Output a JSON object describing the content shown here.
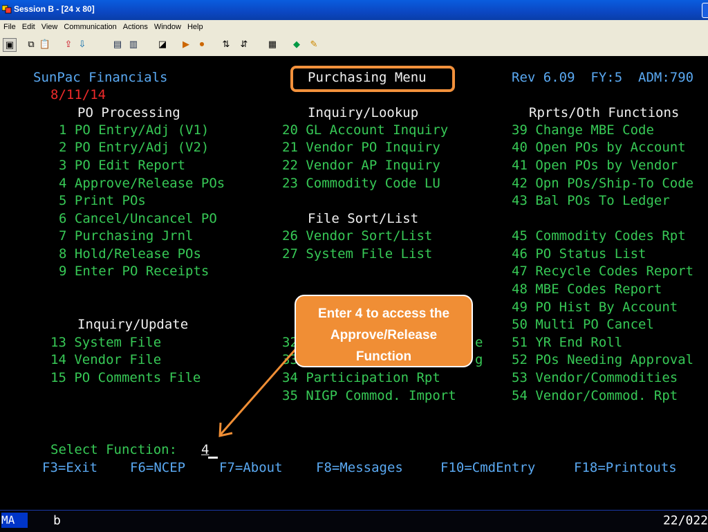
{
  "window": {
    "title": "Session B - [24 x 80]"
  },
  "menu": [
    "File",
    "Edit",
    "View",
    "Communication",
    "Actions",
    "Window",
    "Help"
  ],
  "toolbar_icons": [
    "print-screen-icon",
    "copy-icon",
    "paste-icon",
    "send-icon",
    "receive-icon",
    "display-icon",
    "stop-icon",
    "macro-icon",
    "record-icon",
    "play-icon",
    "transfer-icon",
    "transfer-icon",
    "clipboard-icon",
    "color-icon",
    "edit-icon"
  ],
  "header": {
    "company": "SunPac Financials",
    "menu_title": "Purchasing Menu",
    "rev": "Rev 6.09  FY:5  ADM:790",
    "date": "8/11/14"
  },
  "col1": {
    "heading": "PO Processing",
    "items": [
      {
        "num": "1",
        "label": "PO Entry/Adj (V1)"
      },
      {
        "num": "2",
        "label": "PO Entry/Adj (V2)"
      },
      {
        "num": "3",
        "label": "PO Edit Report"
      },
      {
        "num": "4",
        "label": "Approve/Release POs"
      },
      {
        "num": "5",
        "label": "Print POs"
      },
      {
        "num": "6",
        "label": "Cancel/Uncancel PO"
      },
      {
        "num": "7",
        "label": "Purchasing Jrnl"
      },
      {
        "num": "8",
        "label": "Hold/Release POs"
      },
      {
        "num": "9",
        "label": "Enter PO Receipts"
      }
    ],
    "heading2": "Inquiry/Update",
    "items2": [
      {
        "num": "13",
        "label": "System File"
      },
      {
        "num": "14",
        "label": "Vendor File"
      },
      {
        "num": "15",
        "label": "PO Comments File"
      }
    ]
  },
  "col2": {
    "heading": "Inquiry/Lookup",
    "items": [
      {
        "num": "20",
        "label": "GL Account Inquiry"
      },
      {
        "num": "21",
        "label": "Vendor PO Inquiry"
      },
      {
        "num": "22",
        "label": "Vendor AP Inquiry"
      },
      {
        "num": "23",
        "label": "Commodity Code LU"
      }
    ],
    "heading2": "File Sort/List",
    "items2": [
      {
        "num": "26",
        "label": "Vendor Sort/List"
      },
      {
        "num": "27",
        "label": "System File List"
      }
    ],
    "partial": [
      {
        "num": "32",
        "label": "e"
      },
      {
        "num": "33",
        "label": "g"
      },
      {
        "num": "34",
        "label": "Participation Rpt"
      },
      {
        "num": "35",
        "label": "NIGP Commod. Import"
      }
    ]
  },
  "col3": {
    "heading": "Rprts/Oth Functions",
    "items": [
      {
        "num": "39",
        "label": "Change MBE Code"
      },
      {
        "num": "40",
        "label": "Open POs by Account"
      },
      {
        "num": "41",
        "label": "Open POs by Vendor"
      },
      {
        "num": "42",
        "label": "Opn POs/Ship-To Code"
      },
      {
        "num": "43",
        "label": "Bal POs To Ledger"
      },
      {
        "num": "45",
        "label": "Commodity Codes Rpt"
      },
      {
        "num": "46",
        "label": "PO Status List"
      },
      {
        "num": "47",
        "label": "Recycle Codes Report"
      },
      {
        "num": "48",
        "label": "MBE Codes Report"
      },
      {
        "num": "49",
        "label": "PO Hist By Account"
      },
      {
        "num": "50",
        "label": "Multi PO Cancel"
      },
      {
        "num": "51",
        "label": "YR End Roll"
      },
      {
        "num": "52",
        "label": "POs Needing Approval"
      },
      {
        "num": "53",
        "label": "Vendor/Commodities"
      },
      {
        "num": "54",
        "label": "Vendor/Commod. Rpt"
      }
    ]
  },
  "select": {
    "label": "Select Function:",
    "value": "4"
  },
  "fkeys": [
    "F3=Exit",
    "F6=NCEP",
    "F7=About",
    "F8=Messages",
    "F10=CmdEntry",
    "F18=Printouts"
  ],
  "callout": {
    "lines": [
      "Enter 4 to access the",
      "Approve/Release",
      "Function"
    ]
  },
  "status": {
    "mode": "MA",
    "session": "b",
    "position": "22/022"
  },
  "colors": {
    "green": "#37c956",
    "white": "#f1f1f1",
    "blue": "#5aa9f2",
    "red": "#ef2a2a",
    "orange": "#f08e35"
  }
}
